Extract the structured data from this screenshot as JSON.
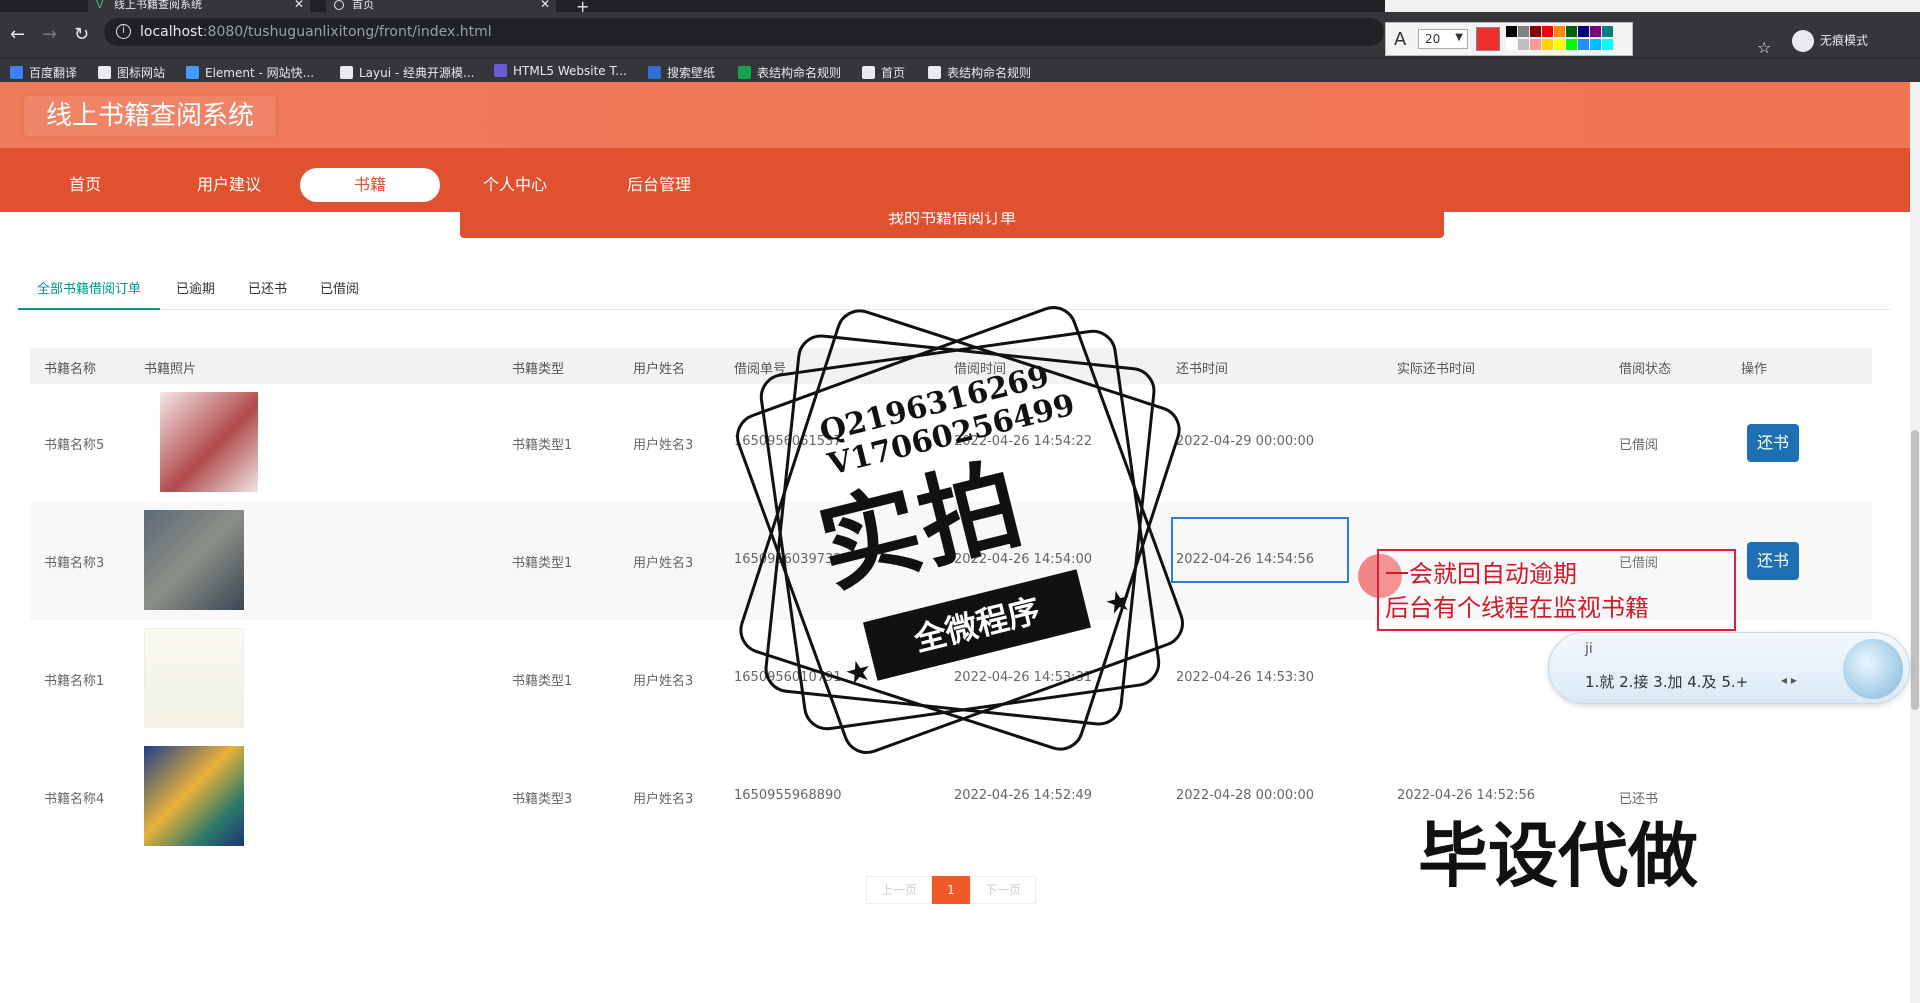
{
  "browser": {
    "tabs": [
      {
        "title": "线上书籍查阅系统",
        "close": "✕"
      },
      {
        "title": "首页",
        "close": "✕"
      }
    ],
    "new_tab": "+",
    "url_host": "localhost",
    "url_rest": ":8080/tushuguanlixitong/front/index.html",
    "incognito_label": "无痕模式",
    "bookmarks": [
      {
        "label": "百度翻译",
        "color": "#3b82f6"
      },
      {
        "label": "图标网站",
        "color": "#e8eaed"
      },
      {
        "label": "Element - 网站快...",
        "color": "#409eff"
      },
      {
        "label": "Layui - 经典开源模...",
        "color": "#e8eaed"
      },
      {
        "label": "HTML5 Website T...",
        "color": "#6b5bd6"
      },
      {
        "label": "搜索壁纸",
        "color": "#2c6fd6"
      },
      {
        "label": "表结构命名规则",
        "color": "#16a34a"
      },
      {
        "label": "首页",
        "color": "#e8eaed"
      },
      {
        "label": "表结构命名规则",
        "color": "#e8eaed"
      }
    ]
  },
  "annotation_tool": {
    "font_size": "20",
    "current_color": "#f03030",
    "swatches": [
      "#000000",
      "#808080",
      "#8b0000",
      "#ff0000",
      "#ff8c00",
      "#006400",
      "#000080",
      "#800080",
      "#008080",
      "#ffffff",
      "#c0c0c0",
      "#ff9999",
      "#ffd700",
      "#ffff00",
      "#00ff00",
      "#1e90ff",
      "#00bfff",
      "#00ffff"
    ]
  },
  "site": {
    "title": "线上书籍查阅系统",
    "nav": [
      "首页",
      "用户建议",
      "书籍",
      "个人中心",
      "后台管理"
    ],
    "active_nav": "书籍",
    "banner_title": "我的书籍借阅订单"
  },
  "subtabs": [
    "全部书籍借阅订单",
    "已逾期",
    "已还书",
    "已借阅"
  ],
  "table": {
    "headers": [
      "书籍名称",
      "书籍照片",
      "书籍类型",
      "用户姓名",
      "借阅单号",
      "借阅时间",
      "还书时间",
      "实际还书时间",
      "借阅状态",
      "操作"
    ],
    "rows": [
      {
        "name": "书籍名称5",
        "type": "书籍类型1",
        "user": "用户姓名3",
        "order": "1650956061537",
        "borrow": "2022-04-26 14:54:22",
        "due": "2022-04-29 00:00:00",
        "actual": "",
        "status": "已借阅",
        "action": "还书"
      },
      {
        "name": "书籍名称3",
        "type": "书籍类型1",
        "user": "用户姓名3",
        "order": "1650956039732",
        "borrow": "2022-04-26 14:54:00",
        "due": "2022-04-26 14:54:56",
        "actual": "",
        "status": "已借阅",
        "action": "还书"
      },
      {
        "name": "书籍名称1",
        "type": "书籍类型1",
        "user": "用户姓名3",
        "order": "1650956010791",
        "borrow": "2022-04-26 14:53:31",
        "due": "2022-04-26 14:53:30",
        "actual": "",
        "status": "",
        "action": ""
      },
      {
        "name": "书籍名称4",
        "type": "书籍类型3",
        "user": "用户姓名3",
        "order": "1650955968890",
        "borrow": "2022-04-26 14:52:49",
        "due": "2022-04-28 00:00:00",
        "actual": "2022-04-26 14:52:56",
        "status": "已还书",
        "action": ""
      }
    ]
  },
  "pager": {
    "prev": "上一页",
    "current": "1",
    "next": "下一页"
  },
  "note": {
    "line1": "一会就回自动逾期",
    "line2": "后台有个线程在监视书籍"
  },
  "ime": {
    "composition": "ji",
    "candidates": "1.就   2.接   3.加   4.及   5.+",
    "arrows": "◂ ▸"
  },
  "watermark": {
    "qq": "Q2196316269",
    "vx": "V17060256499",
    "big": "实拍",
    "ribbon": "全微程序",
    "corner": "毕设代做"
  }
}
